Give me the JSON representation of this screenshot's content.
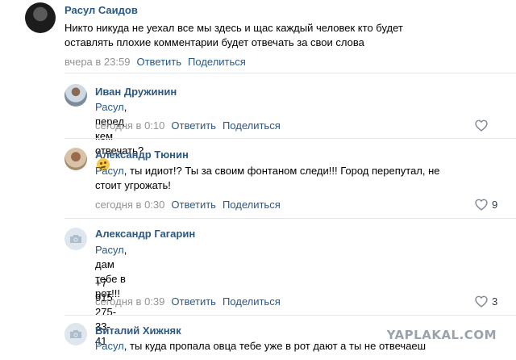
{
  "comments": [
    {
      "author": "Расул Саидов",
      "text_lines": [
        "Никто никуда не уехал все мы здесь и щас каждый человек кто будет",
        "оставлять плохие комментарии будет отвечать за свои слова"
      ],
      "time": "вчера в 23:59",
      "reply_label": "Ответить",
      "share_label": "Поделиться"
    },
    {
      "author": "Иван Дружинин",
      "reply_to": "Расул",
      "text": ", перед кем отвечать?",
      "emoji": "thinking-face",
      "time": "сегодня в 0:10",
      "reply_label": "Ответить",
      "share_label": "Поделиться",
      "likes": ""
    },
    {
      "author": "Александр Тюнин",
      "reply_to": "Расул",
      "text_line1": ", ты идиот!? Ты за своим фонтаном следи!!! Город перепутал, не",
      "text_line2": "стоит угрожать!",
      "time": "сегодня в 0:30",
      "reply_label": "Ответить",
      "share_label": "Поделиться",
      "likes": "9"
    },
    {
      "author": "Александр Гагарин",
      "reply_to": "Расул",
      "text": ", дам тебе в рот!!!",
      "phone": "+7 915 275-33-41",
      "time": "сегодня в 0:39",
      "reply_label": "Ответить",
      "share_label": "Поделиться",
      "likes": "3"
    },
    {
      "author": "Виталий Хижняк",
      "reply_to": "Расул",
      "text": ", ты куда пропала овца тебе уже в рот дают а ты не отвечаеш"
    }
  ],
  "watermark": "YAPLAKAL.COM",
  "colors": {
    "author": "#2a5885",
    "meta": "#939393",
    "divider": "#e7e8ec"
  }
}
